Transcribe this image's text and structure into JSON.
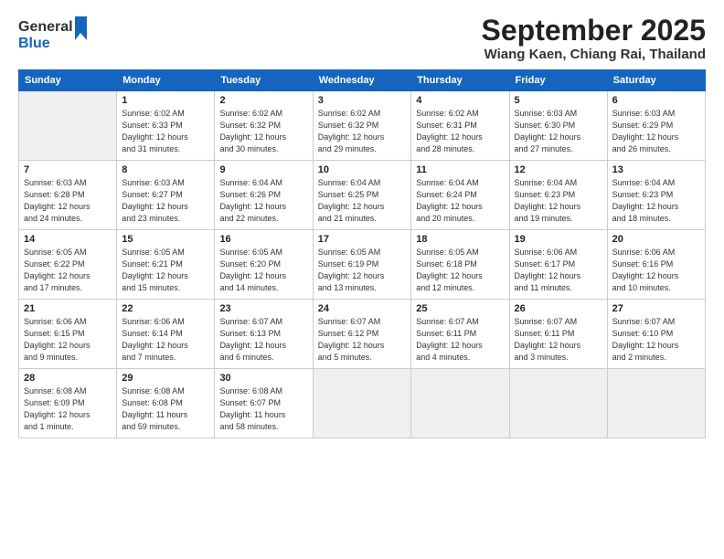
{
  "logo": {
    "line1": "General",
    "line2": "Blue"
  },
  "title": "September 2025",
  "subtitle": "Wiang Kaen, Chiang Rai, Thailand",
  "days_of_week": [
    "Sunday",
    "Monday",
    "Tuesday",
    "Wednesday",
    "Thursday",
    "Friday",
    "Saturday"
  ],
  "weeks": [
    [
      {
        "day": "",
        "info": ""
      },
      {
        "day": "1",
        "info": "Sunrise: 6:02 AM\nSunset: 6:33 PM\nDaylight: 12 hours\nand 31 minutes."
      },
      {
        "day": "2",
        "info": "Sunrise: 6:02 AM\nSunset: 6:32 PM\nDaylight: 12 hours\nand 30 minutes."
      },
      {
        "day": "3",
        "info": "Sunrise: 6:02 AM\nSunset: 6:32 PM\nDaylight: 12 hours\nand 29 minutes."
      },
      {
        "day": "4",
        "info": "Sunrise: 6:02 AM\nSunset: 6:31 PM\nDaylight: 12 hours\nand 28 minutes."
      },
      {
        "day": "5",
        "info": "Sunrise: 6:03 AM\nSunset: 6:30 PM\nDaylight: 12 hours\nand 27 minutes."
      },
      {
        "day": "6",
        "info": "Sunrise: 6:03 AM\nSunset: 6:29 PM\nDaylight: 12 hours\nand 26 minutes."
      }
    ],
    [
      {
        "day": "7",
        "info": "Sunrise: 6:03 AM\nSunset: 6:28 PM\nDaylight: 12 hours\nand 24 minutes."
      },
      {
        "day": "8",
        "info": "Sunrise: 6:03 AM\nSunset: 6:27 PM\nDaylight: 12 hours\nand 23 minutes."
      },
      {
        "day": "9",
        "info": "Sunrise: 6:04 AM\nSunset: 6:26 PM\nDaylight: 12 hours\nand 22 minutes."
      },
      {
        "day": "10",
        "info": "Sunrise: 6:04 AM\nSunset: 6:25 PM\nDaylight: 12 hours\nand 21 minutes."
      },
      {
        "day": "11",
        "info": "Sunrise: 6:04 AM\nSunset: 6:24 PM\nDaylight: 12 hours\nand 20 minutes."
      },
      {
        "day": "12",
        "info": "Sunrise: 6:04 AM\nSunset: 6:23 PM\nDaylight: 12 hours\nand 19 minutes."
      },
      {
        "day": "13",
        "info": "Sunrise: 6:04 AM\nSunset: 6:23 PM\nDaylight: 12 hours\nand 18 minutes."
      }
    ],
    [
      {
        "day": "14",
        "info": "Sunrise: 6:05 AM\nSunset: 6:22 PM\nDaylight: 12 hours\nand 17 minutes."
      },
      {
        "day": "15",
        "info": "Sunrise: 6:05 AM\nSunset: 6:21 PM\nDaylight: 12 hours\nand 15 minutes."
      },
      {
        "day": "16",
        "info": "Sunrise: 6:05 AM\nSunset: 6:20 PM\nDaylight: 12 hours\nand 14 minutes."
      },
      {
        "day": "17",
        "info": "Sunrise: 6:05 AM\nSunset: 6:19 PM\nDaylight: 12 hours\nand 13 minutes."
      },
      {
        "day": "18",
        "info": "Sunrise: 6:05 AM\nSunset: 6:18 PM\nDaylight: 12 hours\nand 12 minutes."
      },
      {
        "day": "19",
        "info": "Sunrise: 6:06 AM\nSunset: 6:17 PM\nDaylight: 12 hours\nand 11 minutes."
      },
      {
        "day": "20",
        "info": "Sunrise: 6:06 AM\nSunset: 6:16 PM\nDaylight: 12 hours\nand 10 minutes."
      }
    ],
    [
      {
        "day": "21",
        "info": "Sunrise: 6:06 AM\nSunset: 6:15 PM\nDaylight: 12 hours\nand 9 minutes."
      },
      {
        "day": "22",
        "info": "Sunrise: 6:06 AM\nSunset: 6:14 PM\nDaylight: 12 hours\nand 7 minutes."
      },
      {
        "day": "23",
        "info": "Sunrise: 6:07 AM\nSunset: 6:13 PM\nDaylight: 12 hours\nand 6 minutes."
      },
      {
        "day": "24",
        "info": "Sunrise: 6:07 AM\nSunset: 6:12 PM\nDaylight: 12 hours\nand 5 minutes."
      },
      {
        "day": "25",
        "info": "Sunrise: 6:07 AM\nSunset: 6:11 PM\nDaylight: 12 hours\nand 4 minutes."
      },
      {
        "day": "26",
        "info": "Sunrise: 6:07 AM\nSunset: 6:11 PM\nDaylight: 12 hours\nand 3 minutes."
      },
      {
        "day": "27",
        "info": "Sunrise: 6:07 AM\nSunset: 6:10 PM\nDaylight: 12 hours\nand 2 minutes."
      }
    ],
    [
      {
        "day": "28",
        "info": "Sunrise: 6:08 AM\nSunset: 6:09 PM\nDaylight: 12 hours\nand 1 minute."
      },
      {
        "day": "29",
        "info": "Sunrise: 6:08 AM\nSunset: 6:08 PM\nDaylight: 11 hours\nand 59 minutes."
      },
      {
        "day": "30",
        "info": "Sunrise: 6:08 AM\nSunset: 6:07 PM\nDaylight: 11 hours\nand 58 minutes."
      },
      {
        "day": "",
        "info": ""
      },
      {
        "day": "",
        "info": ""
      },
      {
        "day": "",
        "info": ""
      },
      {
        "day": "",
        "info": ""
      }
    ]
  ]
}
